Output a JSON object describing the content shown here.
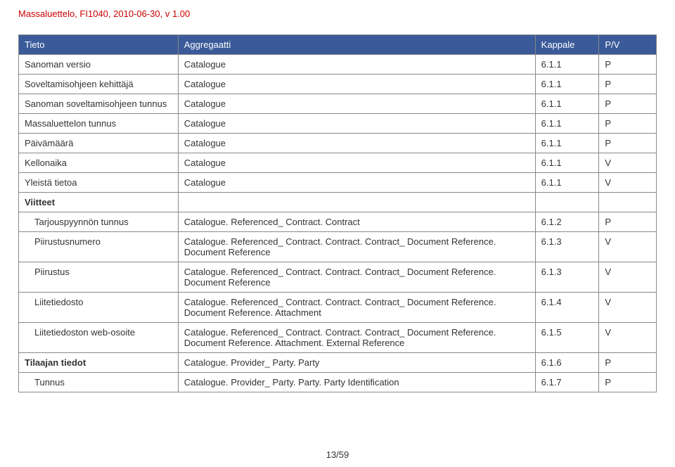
{
  "header": "Massaluettelo, FI1040, 2010-06-30, v 1.00",
  "columns": {
    "c1": "Tieto",
    "c2": "Aggregaatti",
    "c3": "Kappale",
    "c4": "P/V"
  },
  "rows": [
    {
      "tieto": "Sanoman versio",
      "agg": "Catalogue",
      "kappale": "6.1.1",
      "pv": "P"
    },
    {
      "tieto": "Soveltamisohjeen kehittäjä",
      "agg": "Catalogue",
      "kappale": "6.1.1",
      "pv": "P"
    },
    {
      "tieto": "Sanoman soveltamisohjeen tunnus",
      "agg": "Catalogue",
      "kappale": "6.1.1",
      "pv": "P"
    },
    {
      "tieto": "Massaluettelon tunnus",
      "agg": "Catalogue",
      "kappale": "6.1.1",
      "pv": "P"
    },
    {
      "tieto": "Päivämäärä",
      "agg": "Catalogue",
      "kappale": "6.1.1",
      "pv": "P"
    },
    {
      "tieto": "Kellonaika",
      "agg": "Catalogue",
      "kappale": "6.1.1",
      "pv": "V"
    },
    {
      "tieto": "Yleistä tietoa",
      "agg": "Catalogue",
      "kappale": "6.1.1",
      "pv": "V"
    }
  ],
  "section1": {
    "label": "Viitteet",
    "rows": [
      {
        "tieto": "Tarjouspyynnön tunnus",
        "agg": "Catalogue. Referenced_ Contract. Contract",
        "kappale": "6.1.2",
        "pv": "P"
      },
      {
        "tieto": "Piirustusnumero",
        "agg": "Catalogue. Referenced_ Contract. Contract. Contract_ Document Reference. Document Reference",
        "kappale": "6.1.3",
        "pv": "V"
      },
      {
        "tieto": "Piirustus",
        "agg": "Catalogue. Referenced_ Contract. Contract. Contract_ Document Reference. Document Reference",
        "kappale": "6.1.3",
        "pv": "V"
      },
      {
        "tieto": "Liitetiedosto",
        "agg": "Catalogue. Referenced_ Contract. Contract. Contract_ Document Reference. Document Reference. Attachment",
        "kappale": "6.1.4",
        "pv": "V"
      },
      {
        "tieto": "Liitetiedoston web-osoite",
        "agg": "Catalogue. Referenced_ Contract. Contract. Contract_ Document Reference. Document Reference. Attachment. External Reference",
        "kappale": "6.1.5",
        "pv": "V"
      }
    ]
  },
  "tilaajan": {
    "label": "Tilaajan tiedot",
    "agg": "Catalogue. Provider_ Party. Party",
    "kappale": "6.1.6",
    "pv": "P",
    "rows": [
      {
        "tieto": "Tunnus",
        "agg": "Catalogue. Provider_ Party. Party. Party Identification",
        "kappale": "6.1.7",
        "pv": "P"
      }
    ]
  },
  "pagenum": "13/59"
}
